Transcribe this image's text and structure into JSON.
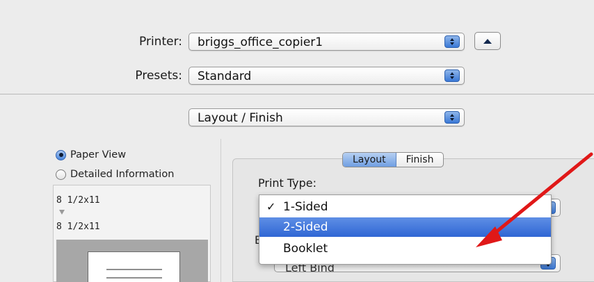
{
  "printer": {
    "label": "Printer:",
    "value": "briggs_office_copier1"
  },
  "presets": {
    "label": "Presets:",
    "value": "Standard"
  },
  "section_popup": {
    "value": "Layout / Finish"
  },
  "view_options": [
    {
      "label": "Paper View",
      "selected": true
    },
    {
      "label": "Detailed Information",
      "selected": false
    }
  ],
  "preview": {
    "size_top": "8 1/2x11",
    "size_bottom": "8 1/2x11"
  },
  "tabs": [
    {
      "label": "Layout",
      "selected": true
    },
    {
      "label": "Finish",
      "selected": false
    }
  ],
  "print_type": {
    "label": "Print Type:",
    "menu_items": [
      {
        "label": "1-Sided",
        "checked": true,
        "check_glyph": "✓",
        "highlighted": false
      },
      {
        "label": "2-Sided",
        "checked": false,
        "check_glyph": "",
        "highlighted": true
      },
      {
        "label": "Booklet",
        "checked": false,
        "check_glyph": "",
        "highlighted": false
      }
    ]
  },
  "behind_menu": {
    "binding_value": "Left Bind",
    "partial_label": "B"
  },
  "annotation": {
    "arrow_color": "#e01818"
  },
  "colors": {
    "accent_blue": "#3a78d6",
    "highlight": "#2f66d4"
  }
}
